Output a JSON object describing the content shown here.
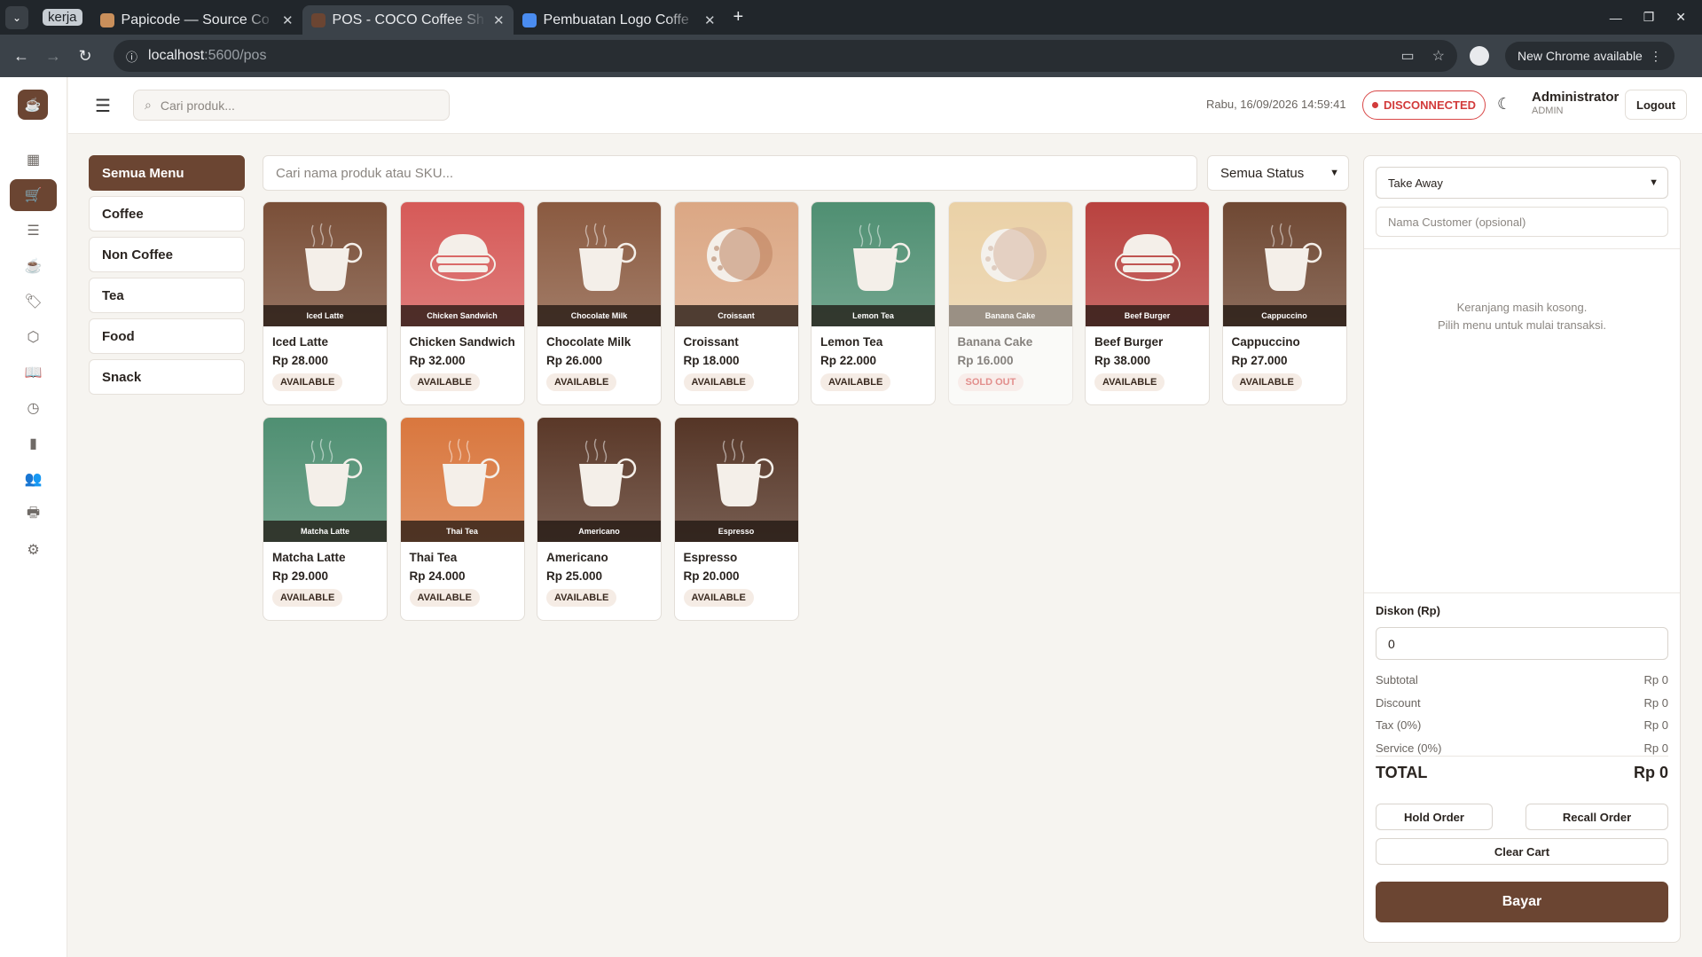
{
  "browser": {
    "group_label": "kerja",
    "tabs": [
      {
        "title": "Papicode — Source Co",
        "favicon_color": "#c98f5b"
      },
      {
        "title": "POS - COCO Coffee Sh",
        "favicon_color": "#6b4532",
        "active": true
      },
      {
        "title": "Pembuatan Logo Coffe",
        "favicon_color": "#4a8cf0"
      }
    ],
    "url_host": "localhost",
    "url_path": ":5600/pos",
    "update_label": "New Chrome available"
  },
  "header": {
    "search_placeholder": "Cari produk...",
    "datetime": "Rabu, 16/09/2026 14:59:41",
    "connection_status": "DISCONNECTED",
    "user_name": "Administrator",
    "user_role": "ADMIN",
    "logout_label": "Logout"
  },
  "sidebar": {
    "items": [
      {
        "icon": "dashboard-icon",
        "glyph": "▦"
      },
      {
        "icon": "cart-icon",
        "glyph": "🛒",
        "active": true
      },
      {
        "icon": "list-icon",
        "glyph": "☰"
      },
      {
        "icon": "cup-icon",
        "glyph": "☕"
      },
      {
        "icon": "tag-icon",
        "glyph": "🏷"
      },
      {
        "icon": "box-icon",
        "glyph": "⬡"
      },
      {
        "icon": "book-icon",
        "glyph": "📖"
      },
      {
        "icon": "clock-icon",
        "glyph": "◷"
      },
      {
        "icon": "chart-icon",
        "glyph": "▮"
      },
      {
        "icon": "users-icon",
        "glyph": "👥"
      },
      {
        "icon": "printer-icon",
        "glyph": "🖶"
      },
      {
        "icon": "settings-icon",
        "glyph": "⚙"
      }
    ]
  },
  "categories": [
    "Semua Menu",
    "Coffee",
    "Non Coffee",
    "Tea",
    "Food",
    "Snack"
  ],
  "product_search_placeholder": "Cari nama produk atau SKU...",
  "status_filter": "Semua Status",
  "products": [
    {
      "name": "Iced Latte",
      "price": "Rp 28.000",
      "status": "AVAILABLE",
      "thumb": "cup",
      "color": "#7a4f38"
    },
    {
      "name": "Chicken Sandwich",
      "price": "Rp 32.000",
      "status": "AVAILABLE",
      "thumb": "plate",
      "color": "#d65a58"
    },
    {
      "name": "Chocolate Milk",
      "price": "Rp 26.000",
      "status": "AVAILABLE",
      "thumb": "cup",
      "color": "#8a5a40"
    },
    {
      "name": "Croissant",
      "price": "Rp 18.000",
      "status": "AVAILABLE",
      "thumb": "moon",
      "color": "#dba784"
    },
    {
      "name": "Lemon Tea",
      "price": "Rp 22.000",
      "status": "AVAILABLE",
      "thumb": "cup",
      "color": "#4f8f72"
    },
    {
      "name": "Banana Cake",
      "price": "Rp 16.000",
      "status": "SOLD OUT",
      "thumb": "moon",
      "color": "#e2b66c"
    },
    {
      "name": "Beef Burger",
      "price": "Rp 38.000",
      "status": "AVAILABLE",
      "thumb": "plate",
      "color": "#b9423f"
    },
    {
      "name": "Cappuccino",
      "price": "Rp 27.000",
      "status": "AVAILABLE",
      "thumb": "cup",
      "color": "#6f4833"
    },
    {
      "name": "Matcha Latte",
      "price": "Rp 29.000",
      "status": "AVAILABLE",
      "thumb": "cup",
      "color": "#4f8f72"
    },
    {
      "name": "Thai Tea",
      "price": "Rp 24.000",
      "status": "AVAILABLE",
      "thumb": "cup",
      "color": "#d9773e"
    },
    {
      "name": "Americano",
      "price": "Rp 25.000",
      "status": "AVAILABLE",
      "thumb": "cup",
      "color": "#5a3828"
    },
    {
      "name": "Espresso",
      "price": "Rp 20.000",
      "status": "AVAILABLE",
      "thumb": "cup",
      "color": "#553526"
    }
  ],
  "cart": {
    "order_type": "Take Away",
    "customer_placeholder": "Nama Customer (opsional)",
    "empty_line1": "Keranjang masih kosong.",
    "empty_line2": "Pilih menu untuk mulai transaksi.",
    "discount_label": "Diskon (Rp)",
    "discount_value": "0",
    "summary": [
      {
        "label": "Subtotal",
        "value": "Rp 0"
      },
      {
        "label": "Discount",
        "value": "Rp 0"
      },
      {
        "label": "Tax (0%)",
        "value": "Rp 0"
      },
      {
        "label": "Service (0%)",
        "value": "Rp 0"
      }
    ],
    "total_label": "TOTAL",
    "total_value": "Rp 0",
    "hold_label": "Hold Order",
    "recall_label": "Recall Order",
    "clear_label": "Clear Cart",
    "pay_label": "Bayar"
  },
  "colors": {
    "accent": "#6b4532",
    "danger": "#d23b3b"
  }
}
